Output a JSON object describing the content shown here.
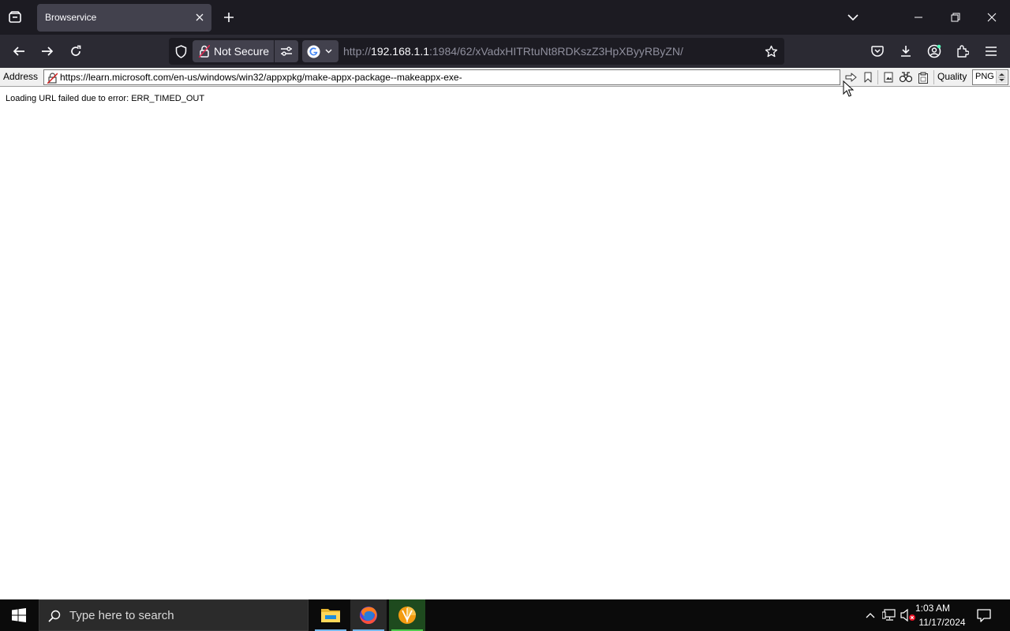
{
  "browser": {
    "tab": {
      "title": "Browservice"
    },
    "urlbar": {
      "security_label": "Not Secure",
      "url_scheme": "http://",
      "url_host": "192.168.1.1",
      "url_rest": ":1984/62/xVadxHITRtuNt8RDKszZ3HpXByyRByZN/"
    }
  },
  "browservice_toolbar": {
    "address_label": "Address",
    "address_value": "https://learn.microsoft.com/en-us/windows/win32/appxpkg/make-appx-package--makeappx-exe-",
    "quality_label": "Quality",
    "quality_value": "PNG"
  },
  "page": {
    "error_message": "Loading URL failed due to error: ERR_TIMED_OUT"
  },
  "taskbar": {
    "search_placeholder": "Type here to search",
    "time": "1:03 AM",
    "date": "11/17/2024"
  },
  "icons": [
    "firefox-view-icon",
    "new-tab-icon",
    "list-all-tabs-icon",
    "minimize-icon",
    "restore-icon",
    "window-close-icon",
    "back-icon",
    "forward-icon",
    "reload-icon",
    "tracking-protection-icon",
    "lock-insecure-icon",
    "permissions-icon",
    "google-icon",
    "bookmark-star-icon",
    "pocket-icon",
    "downloads-icon",
    "account-icon",
    "extensions-icon",
    "menu-icon",
    "broken-lock-icon",
    "go-icon",
    "bookmark-icon",
    "screenshot-icon",
    "find-icon",
    "clipboard-icon",
    "windows-start-icon",
    "search-icon",
    "file-explorer-icon",
    "firefox-icon",
    "app-icon",
    "chevron-up-icon",
    "network-icon",
    "volume-muted-icon",
    "notification-icon"
  ],
  "colors": {
    "tabstrip": "#1c1b22",
    "navbar": "#2b2a33",
    "urlbar": "#1c1b22",
    "taskbar": "#0b0b0b",
    "accent": "#76b9ed"
  }
}
